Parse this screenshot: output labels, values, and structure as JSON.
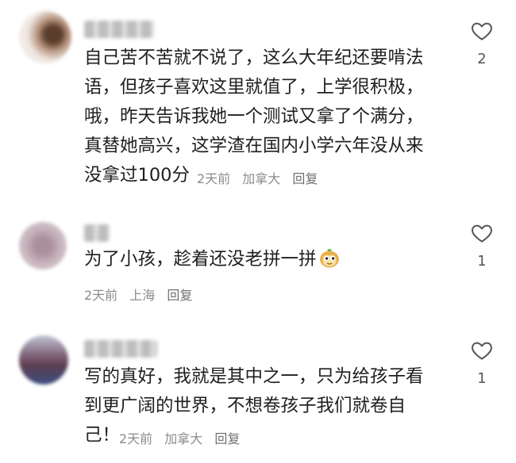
{
  "icons": {
    "like": "heart-outline-icon",
    "sticker": "monkey-sticker-icon"
  },
  "colors": {
    "text": "#1f1f1f",
    "meta": "#8c8c8c",
    "icon": "#555555"
  },
  "comments": [
    {
      "user": "",
      "text_lines": [
        "自己苦不苦就不说了，这么大年纪还要啃法",
        "语，但孩子喜欢这里就值了，上学很积极，",
        "哦，昨天告诉我她一个测试又拿了个满分，",
        "真替她高兴，这学渣在国内小学六年没从来",
        "没拿过100分"
      ],
      "time": "2天前",
      "location": "加拿大",
      "reply": "回复",
      "likes": "2"
    },
    {
      "user": "",
      "text_lines": [
        "为了小孩，趁着还没老拼一拼"
      ],
      "time": "2天前",
      "location": "上海",
      "reply": "回复",
      "likes": "1"
    },
    {
      "user": "",
      "text_lines": [
        "写的真好，我就是其中之一，只为给孩子看",
        "到更广阔的世界，不想卷孩子我们就卷自",
        "己！"
      ],
      "time": "2天前",
      "location": "加拿大",
      "reply": "回复",
      "likes": "1"
    }
  ]
}
